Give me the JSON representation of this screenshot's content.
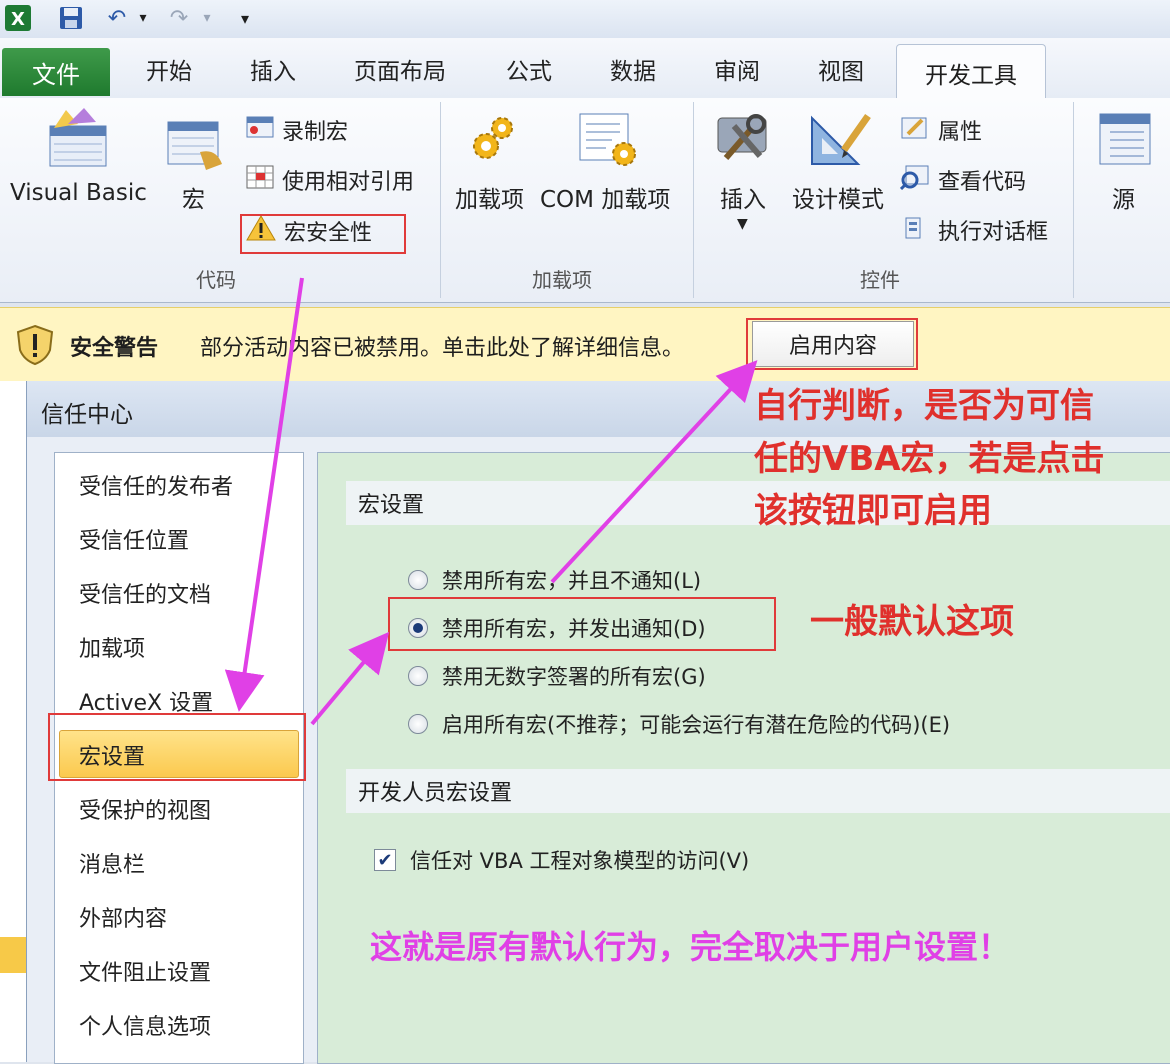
{
  "qat": {
    "app_icon": "excel-icon",
    "save_icon": "save-icon",
    "undo_icon": "undo-icon",
    "redo_icon": "redo-icon",
    "dropdown_icon": "chevron-down-icon"
  },
  "tabs": {
    "file": "文件",
    "home": "开始",
    "insert": "插入",
    "page_layout": "页面布局",
    "formulas": "公式",
    "data": "数据",
    "review": "审阅",
    "view": "视图",
    "developer": "开发工具"
  },
  "ribbon": {
    "code": {
      "visual_basic": "Visual Basic",
      "macros": "宏",
      "record_macro": "录制宏",
      "relative_ref": "使用相对引用",
      "macro_security": "宏安全性",
      "group_label": "代码"
    },
    "addins": {
      "addins": "加载项",
      "com_addins": "COM 加载项",
      "group_label": "加载项"
    },
    "controls": {
      "insert": "插入",
      "design_mode": "设计模式",
      "properties": "属性",
      "view_code": "查看代码",
      "run_dialog": "执行对话框",
      "group_label": "控件"
    },
    "xml": {
      "source": "源"
    }
  },
  "security_bar": {
    "title": "安全警告",
    "message": "部分活动内容已被禁用。单击此处了解详细信息。",
    "enable_button": "启用内容"
  },
  "dialog": {
    "title": "信任中心",
    "nav": [
      "受信任的发布者",
      "受信任位置",
      "受信任的文档",
      "加载项",
      "ActiveX 设置",
      "宏设置",
      "受保护的视图",
      "消息栏",
      "外部内容",
      "文件阻止设置",
      "个人信息选项"
    ],
    "macro_section": "宏设置",
    "options": [
      "禁用所有宏，并且不通知(L)",
      "禁用所有宏，并发出通知(D)",
      "禁用无数字签署的所有宏(G)",
      "启用所有宏(不推荐；可能会运行有潜在危险的代码)(E)"
    ],
    "selected_option": 1,
    "dev_section": "开发人员宏设置",
    "vba_access": "信任对 VBA 工程对象模型的访问(V)",
    "vba_checked": true
  },
  "annotations": {
    "judge_line1": "自行判断，是否为可信",
    "judge_line2": "任的VBA宏，若是点击",
    "judge_line3": "该按钮即可启用",
    "default_note": "一般默认这项",
    "bottom_note": "这就是原有默认行为，完全取决于用户设置！"
  },
  "colors": {
    "annotation_red": "#e0302c",
    "annotation_magenta": "#e040e6",
    "security_bar": "#fff5c2",
    "content_bg": "#d8ecd8"
  }
}
